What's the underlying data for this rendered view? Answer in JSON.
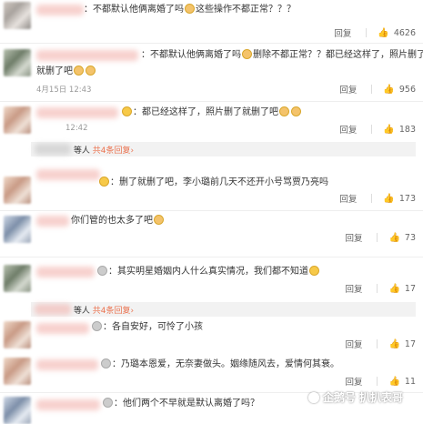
{
  "comments": [
    {
      "text": "：不都默认他俩离婚了吗",
      "emoji_after": "这些操作不都正常？？？",
      "reply": "回复",
      "likes": "4626"
    },
    {
      "text": "：不都默认他俩离婚了吗",
      "emoji_after": "删除不都正常？？都已经这样了，照片删了",
      "line2": "就删了吧",
      "date": "4月15日 12:43",
      "reply": "回复",
      "likes": "956"
    },
    {
      "text": "：都已经这样了，照片删了就删了吧",
      "date": "12:42",
      "reply": "回复",
      "likes": "183",
      "sub_prefix": "等人",
      "sub_link": "共4条回复"
    },
    {
      "text": "：删了就删了吧，李小璐前几天不还开小号骂贾乃亮吗",
      "reply": "回复",
      "likes": "173"
    },
    {
      "text": "你们管的也太多了吧",
      "reply": "回复",
      "likes": "73"
    },
    {
      "text": "：其实明星婚姻内人什么真实情况，我们都不知道",
      "reply": "回复",
      "likes": "17",
      "sub_prefix": "等人",
      "sub_link": "共4条回复"
    },
    {
      "text": "：各自安好，可怜了小孩",
      "reply": "回复",
      "likes": "17"
    },
    {
      "text": "：乃璐本恩爱，无奈妻做头。姻缘随风去，爱情何其衰。",
      "reply": "回复",
      "likes": "11"
    },
    {
      "text": "：他们两个不早就是默认离婚了吗？"
    }
  ],
  "watermark": "企鹅号 扒扒表哥",
  "icons": {
    "like": "thumbs-up-icon",
    "emoji": "smiley-emoji"
  }
}
